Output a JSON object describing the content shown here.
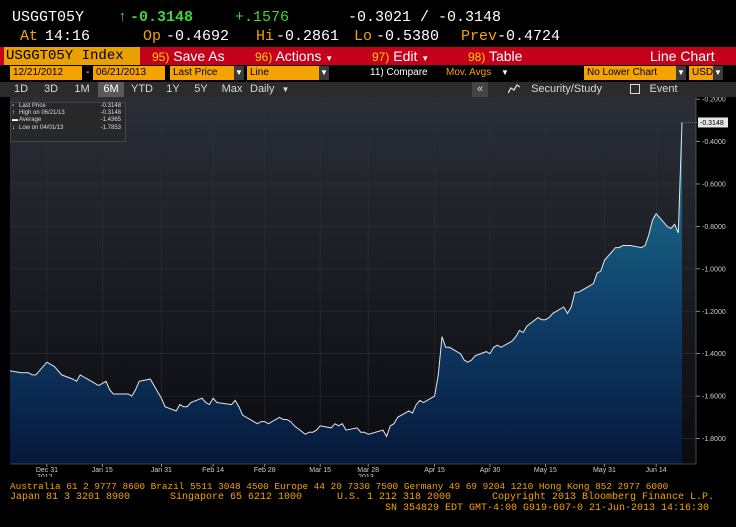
{
  "quote": {
    "ticker": "USGGT05Y",
    "arrow": "↑",
    "last": "-0.3148",
    "change": "+.1576",
    "bid_ask": "-0.3021 / -0.3148",
    "at_label": "At",
    "time": "14:16",
    "open_label": "Op",
    "open": "-0.4692",
    "high_label": "Hi",
    "high": "-0.2861",
    "low_label": "Lo",
    "low": "-0.5380",
    "prev_label": "Prev",
    "prev": "-0.4724"
  },
  "toolbar": {
    "security": "USGGT05Y Index",
    "save_num": "95)",
    "save_label": "Save As",
    "actions_num": "96)",
    "actions_label": "Actions",
    "edit_num": "97)",
    "edit_label": "Edit",
    "table_num": "98)",
    "table_label": "Table",
    "view_title": "Line Chart"
  },
  "controls": {
    "start_date": "12/21/2012",
    "dash": "-",
    "end_date": "06/21/2013",
    "price_field": "Last Price",
    "chart_style": "Line",
    "compare": "11) Compare",
    "mov_avgs": "Mov. Avgs",
    "lower_chart": "No Lower Chart",
    "currency": "USD"
  },
  "periods": {
    "items": [
      "1D",
      "3D",
      "1M",
      "6M",
      "YTD",
      "1Y",
      "5Y",
      "Max"
    ],
    "selected": "6M",
    "frequency": "Daily",
    "collapse": "«",
    "security_study": "Security/Study",
    "event": "Event"
  },
  "legend": {
    "rows": [
      {
        "name": "Last Price",
        "value": "-0.3148"
      },
      {
        "name": "High on 06/21/13",
        "value": "-0.3148"
      },
      {
        "name": "Average",
        "value": "-1.4365"
      },
      {
        "name": "Low on 04/01/13",
        "value": "-1.7853"
      }
    ]
  },
  "chart_data": {
    "type": "area",
    "y_ticks": [
      "-0.2000",
      "-0.4000",
      "-0.6000",
      "-0.8000",
      "-1.0000",
      "-1.2000",
      "-1.4000",
      "-1.6000",
      "-1.8000"
    ],
    "ylim": [
      -1.92,
      -0.19
    ],
    "x_ticks": [
      "Dec 31",
      "Jan 15",
      "Jan 31",
      "Feb 14",
      "Feb 28",
      "Mar 15",
      "Mar 28",
      "Apr 15",
      "Apr 30",
      "May 15",
      "May 31",
      "Jun 14"
    ],
    "year_labels": [
      {
        "at": "Dec 31",
        "year": "2012"
      },
      {
        "at": "Mar 28",
        "year": "2013"
      }
    ],
    "last_value_tag": "-0.3148",
    "series": [
      {
        "x": [
          "2012-12-21",
          "2012-12-24",
          "2012-12-26",
          "2012-12-27",
          "2012-12-28",
          "2012-12-31",
          "2013-01-02",
          "2013-01-03",
          "2013-01-04",
          "2013-01-07",
          "2013-01-08",
          "2013-01-09",
          "2013-01-10",
          "2013-01-11",
          "2013-01-14",
          "2013-01-15",
          "2013-01-16",
          "2013-01-17",
          "2013-01-18",
          "2013-01-22",
          "2013-01-23",
          "2013-01-24",
          "2013-01-25",
          "2013-01-28",
          "2013-01-29",
          "2013-01-30",
          "2013-01-31",
          "2013-02-01",
          "2013-02-04",
          "2013-02-05",
          "2013-02-06",
          "2013-02-07",
          "2013-02-08",
          "2013-02-11",
          "2013-02-12",
          "2013-02-13",
          "2013-02-14",
          "2013-02-15",
          "2013-02-19",
          "2013-02-20",
          "2013-02-21",
          "2013-02-22",
          "2013-02-25",
          "2013-02-26",
          "2013-02-27",
          "2013-02-28",
          "2013-03-01",
          "2013-03-04",
          "2013-03-05",
          "2013-03-06",
          "2013-03-07",
          "2013-03-08",
          "2013-03-11",
          "2013-03-12",
          "2013-03-13",
          "2013-03-14",
          "2013-03-15",
          "2013-03-18",
          "2013-03-19",
          "2013-03-20",
          "2013-03-21",
          "2013-03-22",
          "2013-03-25",
          "2013-03-26",
          "2013-03-27",
          "2013-03-28",
          "2013-04-01",
          "2013-04-02",
          "2013-04-03",
          "2013-04-04",
          "2013-04-05",
          "2013-04-08",
          "2013-04-09",
          "2013-04-10",
          "2013-04-11",
          "2013-04-12",
          "2013-04-15",
          "2013-04-16",
          "2013-04-17",
          "2013-04-18",
          "2013-04-19",
          "2013-04-22",
          "2013-04-23",
          "2013-04-24",
          "2013-04-25",
          "2013-04-26",
          "2013-04-29",
          "2013-04-30",
          "2013-05-01",
          "2013-05-02",
          "2013-05-03",
          "2013-05-06",
          "2013-05-07",
          "2013-05-08",
          "2013-05-09",
          "2013-05-10",
          "2013-05-13",
          "2013-05-14",
          "2013-05-15",
          "2013-05-16",
          "2013-05-17",
          "2013-05-20",
          "2013-05-21",
          "2013-05-22",
          "2013-05-23",
          "2013-05-24",
          "2013-05-28",
          "2013-05-29",
          "2013-05-30",
          "2013-05-31",
          "2013-06-03",
          "2013-06-04",
          "2013-06-05",
          "2013-06-06",
          "2013-06-07",
          "2013-06-10",
          "2013-06-11",
          "2013-06-12",
          "2013-06-13",
          "2013-06-14",
          "2013-06-17",
          "2013-06-18",
          "2013-06-19",
          "2013-06-20",
          "2013-06-21"
        ],
        "values": [
          -1.48,
          -1.49,
          -1.49,
          -1.5,
          -1.5,
          -1.44,
          -1.46,
          -1.48,
          -1.5,
          -1.52,
          -1.53,
          -1.5,
          -1.51,
          -1.52,
          -1.55,
          -1.54,
          -1.53,
          -1.57,
          -1.59,
          -1.59,
          -1.6,
          -1.57,
          -1.53,
          -1.52,
          -1.55,
          -1.58,
          -1.61,
          -1.65,
          -1.67,
          -1.64,
          -1.65,
          -1.65,
          -1.63,
          -1.61,
          -1.63,
          -1.64,
          -1.61,
          -1.63,
          -1.64,
          -1.62,
          -1.65,
          -1.69,
          -1.72,
          -1.73,
          -1.72,
          -1.72,
          -1.73,
          -1.7,
          -1.71,
          -1.71,
          -1.72,
          -1.74,
          -1.78,
          -1.77,
          -1.77,
          -1.76,
          -1.74,
          -1.75,
          -1.73,
          -1.74,
          -1.73,
          -1.76,
          -1.75,
          -1.77,
          -1.77,
          -1.78,
          -1.76,
          -1.79,
          -1.74,
          -1.73,
          -1.7,
          -1.67,
          -1.68,
          -1.64,
          -1.62,
          -1.63,
          -1.6,
          -1.5,
          -1.32,
          -1.37,
          -1.37,
          -1.4,
          -1.43,
          -1.44,
          -1.43,
          -1.41,
          -1.39,
          -1.4,
          -1.37,
          -1.36,
          -1.37,
          -1.34,
          -1.32,
          -1.29,
          -1.3,
          -1.27,
          -1.23,
          -1.24,
          -1.24,
          -1.23,
          -1.21,
          -1.18,
          -1.21,
          -1.18,
          -1.11,
          -1.11,
          -1.07,
          -1.02,
          -1.01,
          -0.96,
          -0.9,
          -0.9,
          -0.89,
          -0.89,
          -0.89,
          -0.9,
          -0.89,
          -0.84,
          -0.77,
          -0.74,
          -0.8,
          -0.81,
          -0.79,
          -0.83,
          -0.31
        ]
      }
    ],
    "colors": {
      "line": "#ffffff",
      "fill_top": "#1a6f8a",
      "fill_bottom": "#071a3a",
      "background": "#15171e"
    }
  },
  "footer": {
    "line1": "Australia 61 2 9777 8600 Brazil 5511 3048 4500 Europe 44 20 7330 7500 Germany 49 69 9204 1210 Hong Kong 852 2977 6000",
    "line2a": "Japan 81 3 3201 8900",
    "line2b": "Singapore 65 6212 1000",
    "line2c": "U.S. 1 212 318 2000",
    "line2d": "Copyright 2013 Bloomberg Finance L.P.",
    "line3": "SN 354829 EDT  GMT-4:00 G919-607-0 21-Jun-2013 14:16:30"
  }
}
